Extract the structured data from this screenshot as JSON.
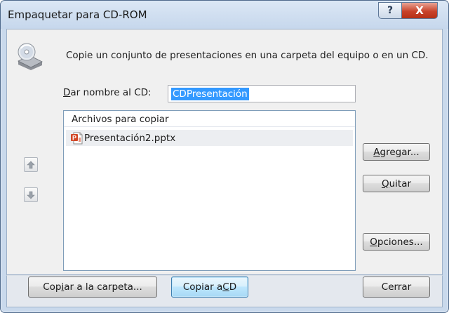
{
  "window": {
    "title": "Empaquetar para CD-ROM",
    "help_label": "?",
    "close_label": "X"
  },
  "description": "Copie un conjunto de presentaciones en una carpeta del equipo o en un CD.",
  "cd_name": {
    "label_pre": "D",
    "label_rest": "ar nombre al CD:",
    "value": "CDPresentación"
  },
  "file_list": {
    "header": "Archivos para copiar",
    "files": [
      {
        "name": "Presentación2.pptx",
        "icon": "powerpoint-file-icon"
      }
    ]
  },
  "side_buttons": {
    "add": {
      "pre": "",
      "key": "A",
      "rest": "gregar..."
    },
    "remove": {
      "pre": "",
      "key": "Q",
      "rest": "uitar"
    },
    "options": {
      "pre": "",
      "key": "O",
      "rest": "pciones..."
    }
  },
  "footer_buttons": {
    "copy_folder": {
      "pre": "Cop",
      "key": "i",
      "rest": "ar a la carpeta..."
    },
    "copy_cd": {
      "pre": "Copiar a ",
      "key": "C",
      "rest": "D"
    },
    "close": {
      "pre": "Cerrar",
      "key": "",
      "rest": ""
    }
  },
  "icons": {
    "move_up": "arrow-up-icon",
    "move_down": "arrow-down-icon",
    "cd": "cd-drive-icon"
  },
  "colors": {
    "frame": "#c9d9ec",
    "close_red": "#c9432b",
    "selection": "#3399ff"
  }
}
